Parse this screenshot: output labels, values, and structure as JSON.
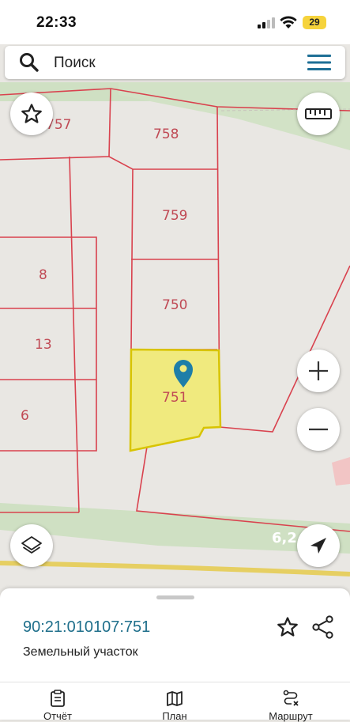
{
  "status_bar": {
    "time": "22:33",
    "battery": "29"
  },
  "search": {
    "placeholder": "Поиск"
  },
  "map": {
    "parcels": [
      {
        "label": "757"
      },
      {
        "label": "758"
      },
      {
        "label": "759"
      },
      {
        "label": "750"
      },
      {
        "label": "751",
        "selected": true
      },
      {
        "label": "8"
      },
      {
        "label": "13"
      },
      {
        "label": "6"
      }
    ],
    "road_label": "6,2",
    "colors": {
      "parcel_border": "#d9424e",
      "selected_fill": "#f0ea7e",
      "selected_border": "#d8c400",
      "pin": "#1e7ea8",
      "green_area": "#cfe0c3",
      "road": "#e6cf62"
    }
  },
  "sheet": {
    "cadastral_number": "90:21:010107:751",
    "property_type": "Земельный участок"
  },
  "bottom_nav": {
    "items": [
      {
        "label": "Отчёт",
        "icon": "clipboard-icon"
      },
      {
        "label": "План",
        "icon": "map-icon"
      },
      {
        "label": "Маршрут",
        "icon": "route-icon"
      }
    ]
  }
}
